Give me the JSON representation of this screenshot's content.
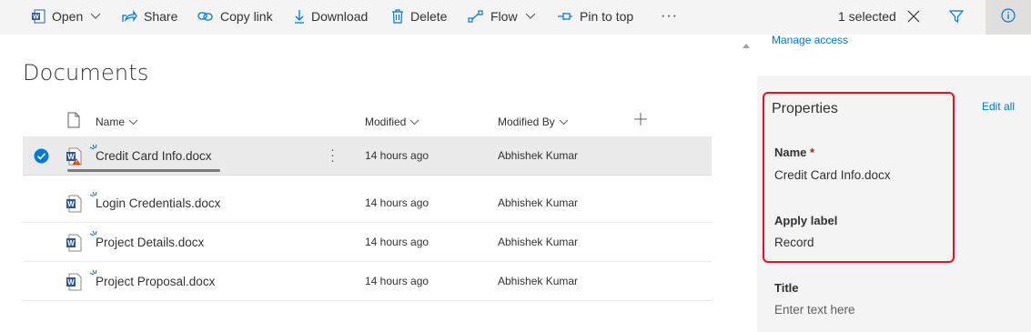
{
  "commandbar": {
    "open": "Open",
    "share": "Share",
    "copy_link": "Copy link",
    "download": "Download",
    "delete": "Delete",
    "flow": "Flow",
    "pin_to_top": "Pin to top",
    "more": "···",
    "selected": "1 selected"
  },
  "documents": {
    "title": "Documents",
    "columns": {
      "name": "Name",
      "modified": "Modified",
      "modified_by": "Modified By"
    },
    "rows": [
      {
        "name": "Credit Card Info.docx",
        "modified": "14 hours ago",
        "modified_by": "Abhishek Kumar",
        "selected": true
      },
      {
        "name": "Login Credentials.docx",
        "modified": "14 hours ago",
        "modified_by": "Abhishek Kumar",
        "selected": false
      },
      {
        "name": "Project Details.docx",
        "modified": "14 hours ago",
        "modified_by": "Abhishek Kumar",
        "selected": false
      },
      {
        "name": "Project Proposal.docx",
        "modified": "14 hours ago",
        "modified_by": "Abhishek Kumar",
        "selected": false
      }
    ]
  },
  "details": {
    "manage_access": "Manage access",
    "properties_title": "Properties",
    "edit_all": "Edit all",
    "name_label": "Name",
    "required_mark": "*",
    "name_value": "Credit Card Info.docx",
    "apply_label_label": "Apply label",
    "apply_label_value": "Record",
    "title_label": "Title",
    "title_placeholder": "Enter text here"
  },
  "colors": {
    "accent": "#0078d4",
    "highlight_box": "#e81123",
    "word_blue": "#2b579a",
    "selected_row": "#eaeaea"
  },
  "icons": [
    "word-doc-icon",
    "share-icon",
    "link-icon",
    "download-icon",
    "trash-icon",
    "flow-icon",
    "pin-icon",
    "close-icon",
    "filter-icon",
    "info-icon",
    "checkmark-icon",
    "warning-icon",
    "add-icon",
    "chevron-down-icon"
  ]
}
